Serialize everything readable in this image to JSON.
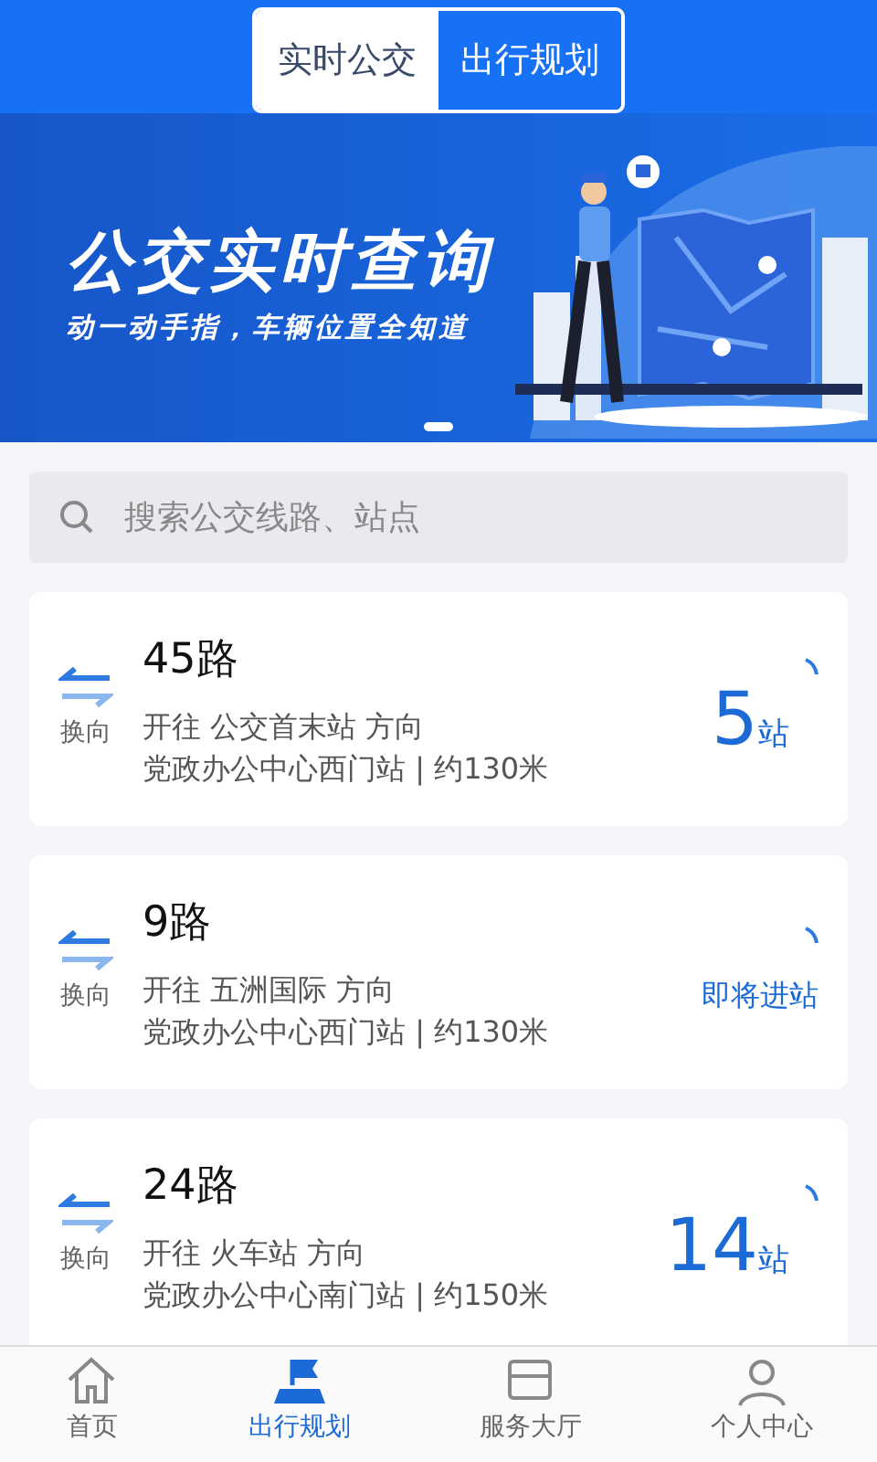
{
  "tabs": [
    {
      "label": "实时公交",
      "selected": true
    },
    {
      "label": "出行规划",
      "selected": false
    }
  ],
  "banner": {
    "title": "公交实时查询",
    "subtitle": "动一动手指，车辆位置全知道",
    "pages": [
      {
        "selected": true
      }
    ]
  },
  "search": {
    "placeholder": "搜索公交线路、站点"
  },
  "routes": [
    {
      "name": "45路",
      "switch_label": "换向",
      "direction": "开往 公交首末站 方向",
      "station": "党政办公中心西门站 | 约130米",
      "arrival": {
        "kind": "stops",
        "count": "5",
        "unit": "站"
      }
    },
    {
      "name": "9路",
      "switch_label": "换向",
      "direction": "开往 五洲国际 方向",
      "station": "党政办公中心西门站 | 约130米",
      "arrival": {
        "kind": "status",
        "text": "即将进站"
      }
    },
    {
      "name": "24路",
      "switch_label": "换向",
      "direction": "开往 火车站 方向",
      "station": "党政办公中心南门站 | 约150米",
      "arrival": {
        "kind": "stops",
        "count": "14",
        "unit": "站"
      }
    }
  ],
  "bottom_nav": [
    {
      "label": "首页",
      "selected": false
    },
    {
      "label": "出行规划",
      "selected": true
    },
    {
      "label": "服务大厅",
      "selected": false
    },
    {
      "label": "个人中心",
      "selected": false
    }
  ]
}
